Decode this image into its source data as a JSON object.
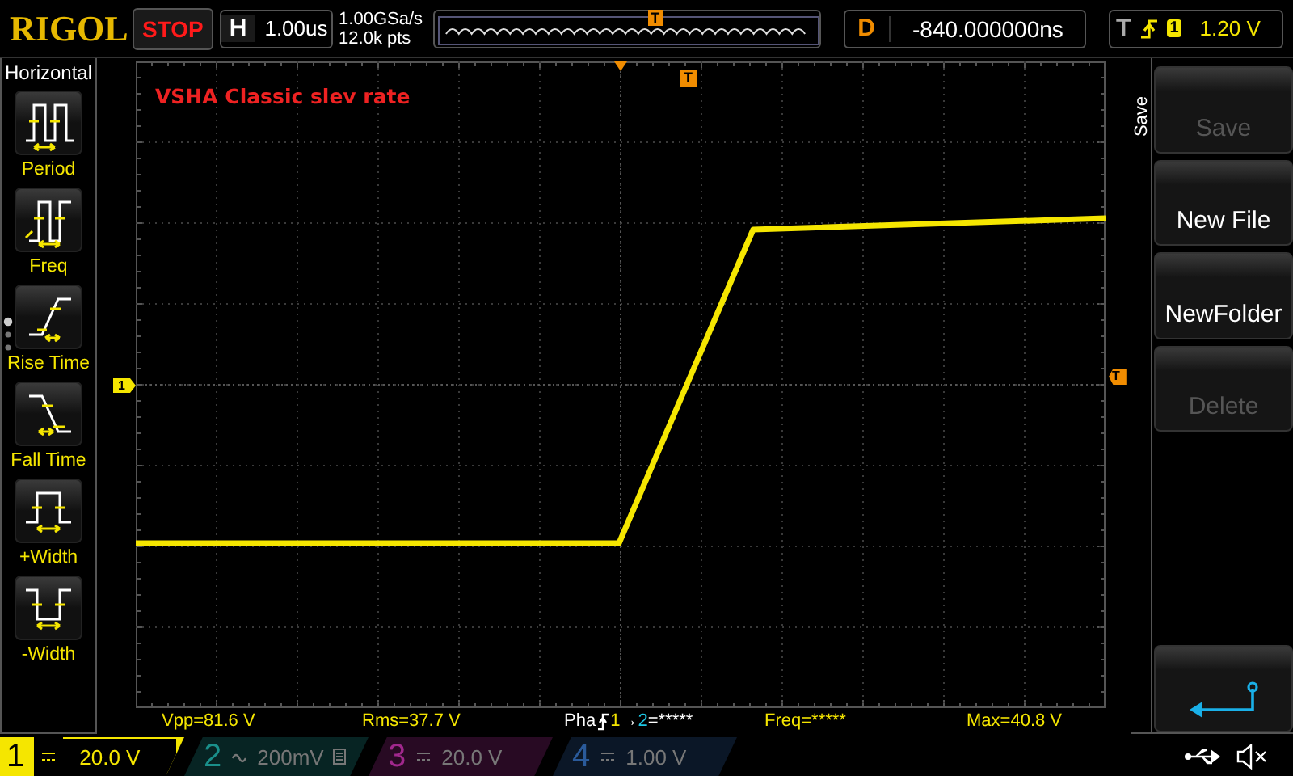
{
  "header": {
    "logo": "RIGOL",
    "run_state": "STOP",
    "timebase": {
      "label": "H",
      "value": "1.00us"
    },
    "sample_rate": "1.00GSa/s",
    "memory_depth": "12.0k pts",
    "overview_marker": "T",
    "delay": {
      "label": "D",
      "value": "-840.000000ns"
    },
    "trigger": {
      "label": "T",
      "source": "1",
      "level": "1.20 V"
    }
  },
  "measure_menu": {
    "title": "Horizontal",
    "items": [
      {
        "kind": "period",
        "label": "Period"
      },
      {
        "kind": "freq",
        "label": "Freq"
      },
      {
        "kind": "rise",
        "label": "Rise Time"
      },
      {
        "kind": "fall",
        "label": "Fall Time"
      },
      {
        "kind": "pwidth",
        "label": "+Width"
      },
      {
        "kind": "nwidth",
        "label": "-Width"
      }
    ]
  },
  "scope": {
    "annotation": "VSHA Classic slev rate",
    "channel_marker": "1",
    "trigger_marker": "T",
    "trigger_level_marker": "T"
  },
  "measurements": [
    {
      "kind": "plain",
      "text": "Vpp=81.6 V"
    },
    {
      "kind": "plain",
      "text": "Rms=37.7 V"
    },
    {
      "kind": "phase",
      "prefix": "Pha",
      "from": "1",
      "arrow": "→",
      "to": "2",
      "value": "=*****"
    },
    {
      "kind": "plain",
      "text": "Freq=*****"
    },
    {
      "kind": "plain",
      "text": "Max=40.8 V"
    }
  ],
  "save_menu": {
    "title": "Save",
    "buttons": [
      {
        "kind": "text",
        "label": "Save",
        "disabled": true
      },
      {
        "kind": "text",
        "label": "New File",
        "disabled": false
      },
      {
        "kind": "text",
        "label": "NewFolder",
        "disabled": false
      },
      {
        "kind": "text",
        "label": "Delete",
        "disabled": true
      },
      {
        "kind": "back"
      }
    ]
  },
  "channels": [
    {
      "number": "1",
      "ac_coupled": false,
      "scale": "20.0 V",
      "selected": true,
      "bw_limit": false,
      "color": "#f5e600"
    },
    {
      "number": "2",
      "ac_coupled": true,
      "scale": "200mV",
      "selected": false,
      "bw_limit": true,
      "color": "#1a8f8a"
    },
    {
      "number": "3",
      "ac_coupled": false,
      "scale": "20.0 V",
      "selected": false,
      "bw_limit": false,
      "color": "#a0288c"
    },
    {
      "number": "4",
      "ac_coupled": false,
      "scale": "1.00 V",
      "selected": false,
      "bw_limit": false,
      "color": "#2a5a9a"
    }
  ]
}
